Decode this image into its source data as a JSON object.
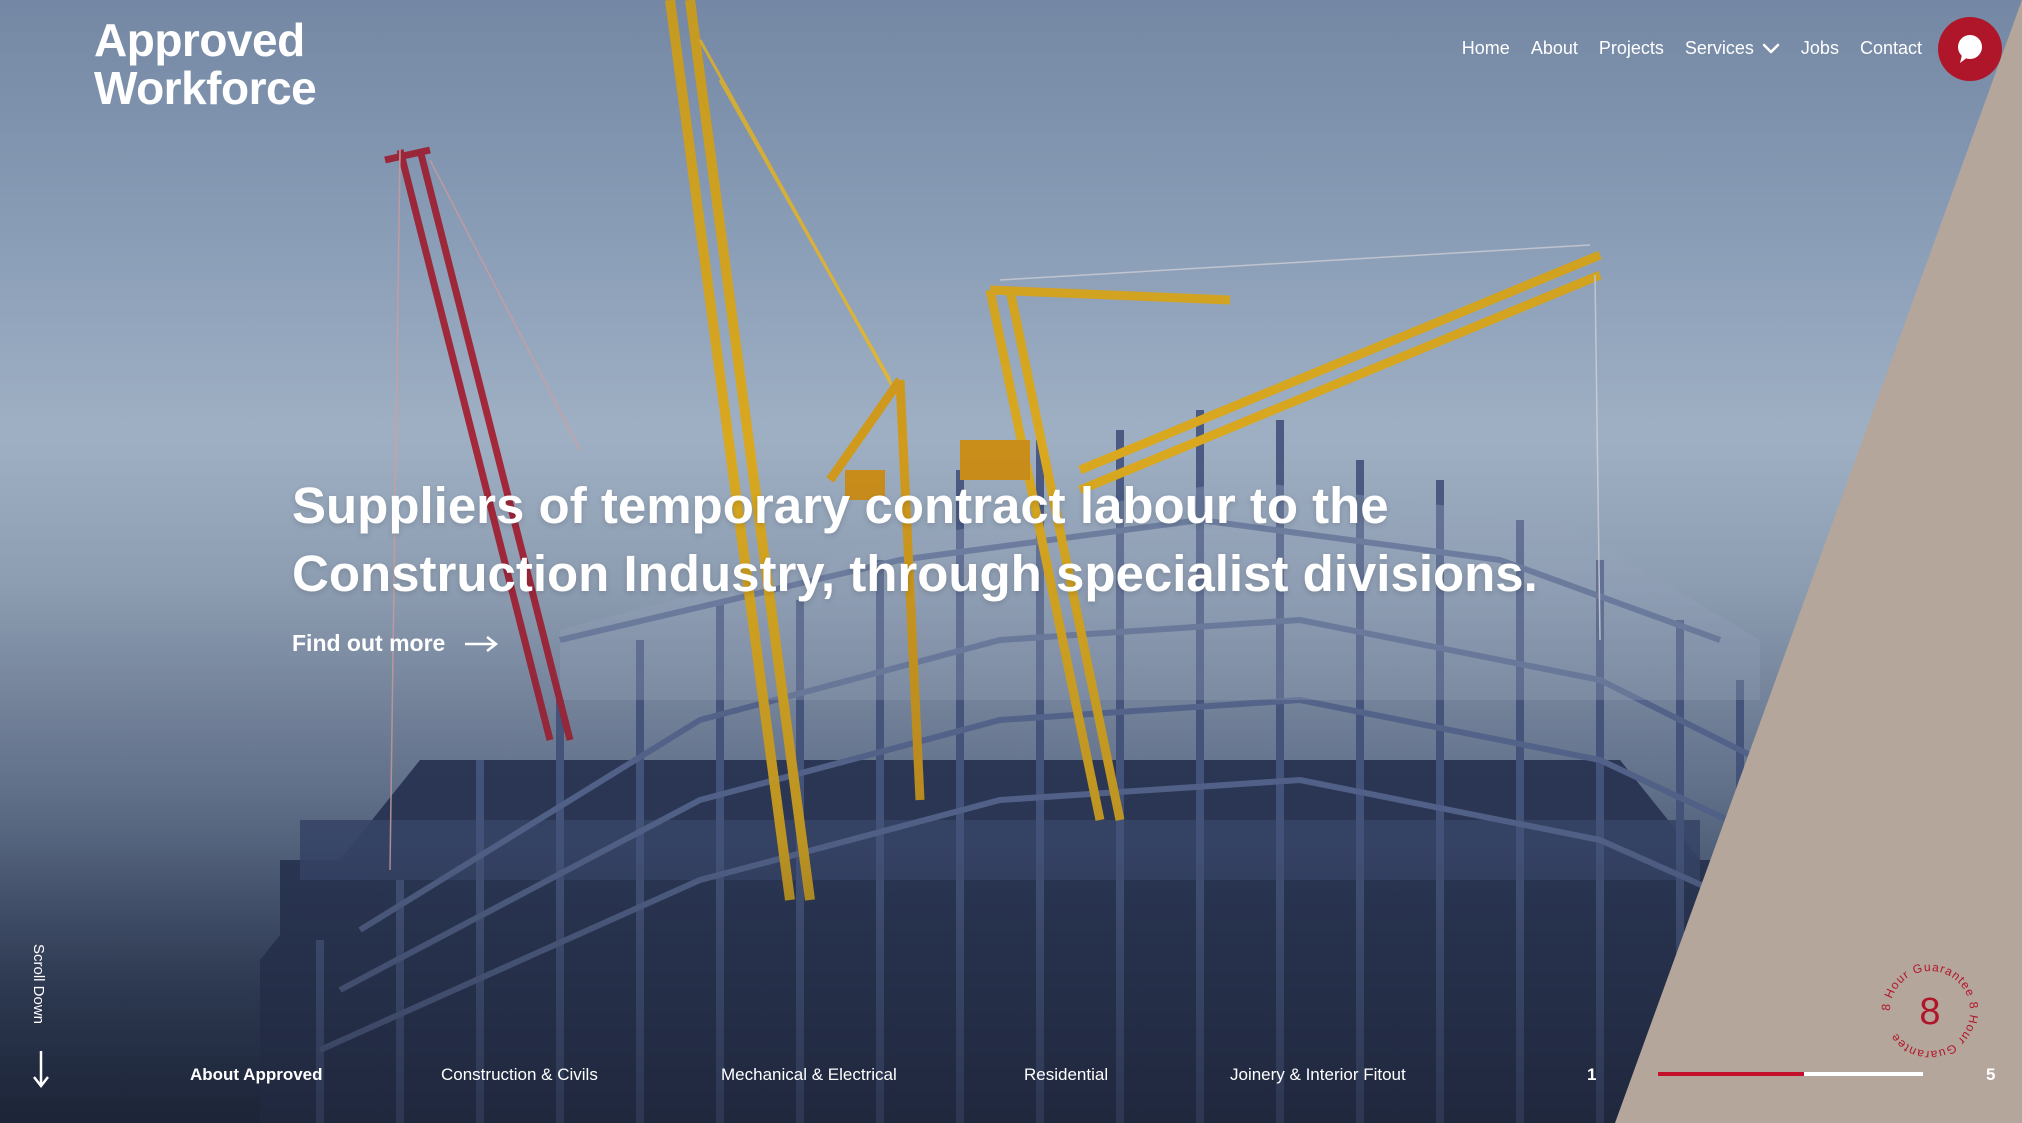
{
  "brand": {
    "logo_line1": "Approved",
    "logo_line2": "Workforce"
  },
  "nav": {
    "items": [
      "Home",
      "About",
      "Projects",
      "Services",
      "Jobs",
      "Contact"
    ]
  },
  "hero": {
    "headline_line1": "Suppliers of temporary contract labour to the",
    "headline_line2": "Construction Industry, through specialist divisions.",
    "cta_label": "Find out more"
  },
  "scroll": {
    "label": "Scroll Down"
  },
  "tabs": {
    "items": [
      "About Approved",
      "Construction & Civils",
      "Mechanical & Electrical",
      "Residential",
      "Joinery & Interior Fitout"
    ],
    "active": "About Approved"
  },
  "pager": {
    "current": "1",
    "total": "5",
    "progress_fraction": 0.55
  },
  "badge": {
    "number": "8",
    "ring_text": "8 Hour Guarantee 8 Hour Guarantee"
  },
  "colors": {
    "accent": "#c3102b",
    "chat_button": "#b0162a",
    "side_panel": "#b5a69c",
    "text": "#ffffff"
  },
  "icons": [
    "chevron-down-icon",
    "chat-bubble-icon",
    "arrow-right-icon",
    "arrow-down-icon"
  ]
}
